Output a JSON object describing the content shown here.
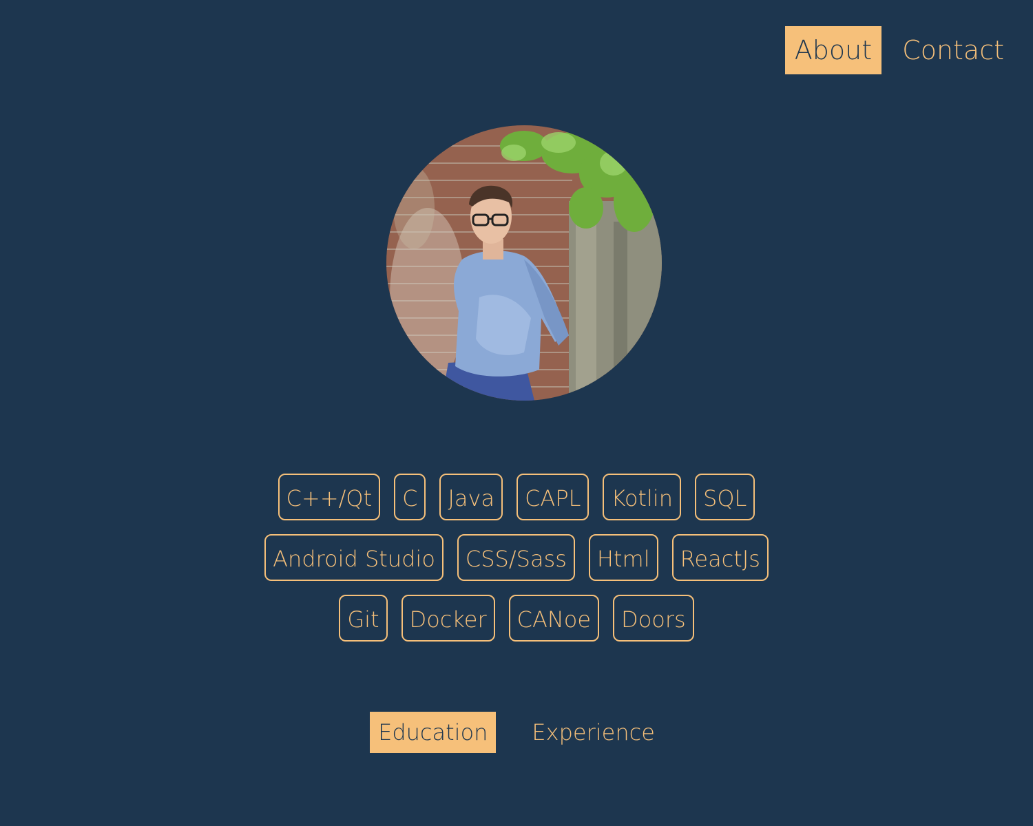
{
  "nav": {
    "about": "About",
    "contact": "Contact"
  },
  "skills": {
    "rows": [
      [
        "C++/Qt",
        "C",
        "Java",
        "CAPL",
        "Kotlin",
        "SQL"
      ],
      [
        "Android Studio",
        "CSS/Sass",
        "Html",
        "ReactJs"
      ],
      [
        "Git",
        "Docker",
        "CANoe",
        "Doors"
      ]
    ]
  },
  "tabs": {
    "education": "Education",
    "experience": "Experience"
  },
  "colors": {
    "background": "#1d364f",
    "accent": "#f6c07a"
  }
}
